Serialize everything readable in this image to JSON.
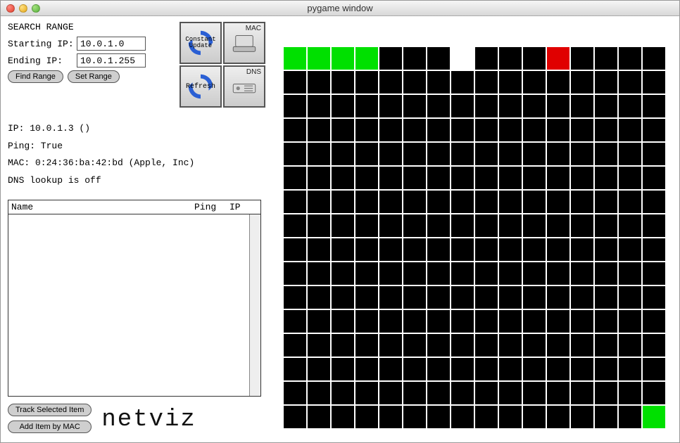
{
  "window": {
    "title": "pygame window"
  },
  "search": {
    "title": "SEARCH RANGE",
    "start_label": "Starting IP:",
    "start_value": "10.0.1.0",
    "end_label": "Ending IP:",
    "end_value": "10.0.1.255",
    "find_btn": "Find Range",
    "set_btn": "Set Range"
  },
  "icon_buttons": {
    "constant_update": "Constant Update",
    "mac": "MAC",
    "refresh": "Refresh",
    "dns": "DNS"
  },
  "info": {
    "ip": "IP: 10.0.1.3 ()",
    "ping": "Ping: True",
    "mac": "MAC: 0:24:36:ba:42:bd (Apple, Inc)",
    "dns": "DNS lookup is off"
  },
  "list": {
    "col_name": "Name",
    "col_ping": "Ping",
    "col_ip": "IP"
  },
  "bottom": {
    "track_btn": "Track Selected Item",
    "add_btn": "Add Item by MAC"
  },
  "brand": "netviz",
  "grid": {
    "cols": 16,
    "rows": 16,
    "special": {
      "green": [
        0,
        1,
        2,
        3,
        255
      ],
      "red": [
        11
      ],
      "white": [
        7
      ]
    }
  }
}
